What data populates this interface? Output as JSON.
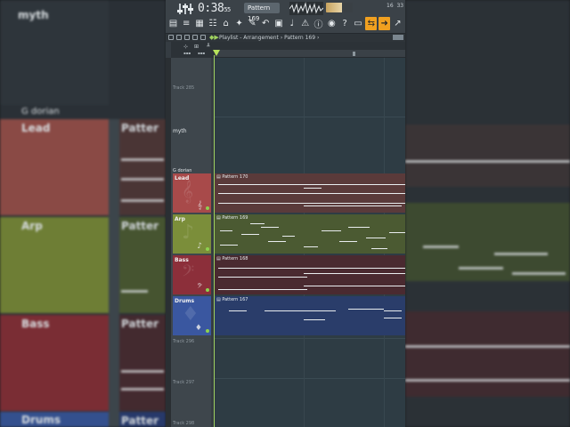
{
  "toolbar": {
    "time": "0:38",
    "time_small": "55",
    "pattern_selector": "Pattern 169",
    "counter_a": "16",
    "counter_b": "33"
  },
  "playlist": {
    "title": "Playlist - Arrangement › Pattern 169 ›"
  },
  "tracks": {
    "track_285": "Track 285",
    "myth": "myth",
    "key": "G dorian",
    "track_296": "Track 296",
    "track_297": "Track 297",
    "track_298": "Track 298"
  },
  "instruments": [
    {
      "name": "Lead",
      "pattern": "Pattern 170",
      "color": "#a84a4a",
      "pcolor": "#5a3a3a",
      "clef": "𝄞"
    },
    {
      "name": "Arp",
      "pattern": "Pattern 169",
      "color": "#7b8e3a",
      "pcolor": "#4b5a32",
      "clef": "♪"
    },
    {
      "name": "Bass",
      "pattern": "Pattern 168",
      "color": "#8c2f3a",
      "pcolor": "#4a2a30",
      "clef": "𝄢"
    },
    {
      "name": "Drums",
      "pattern": "Pattern 167",
      "color": "#3a57a0",
      "pcolor": "#2a3d6a",
      "clef": "♦"
    }
  ],
  "background": {
    "left_myth": "myth",
    "left_key": "G dorian",
    "left_lead": "Lead",
    "left_arp": "Arp",
    "left_bass": "Bass",
    "left_drums": "Drums",
    "left_pattern": "Patter"
  }
}
